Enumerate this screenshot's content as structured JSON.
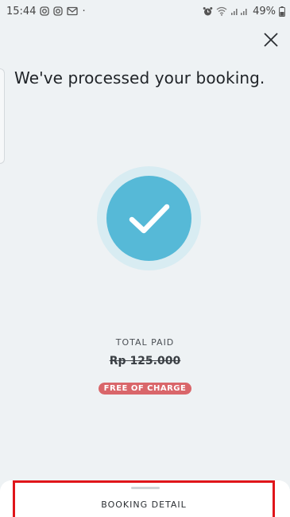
{
  "status_bar": {
    "time": "15:44",
    "battery": "49%"
  },
  "header": {
    "title": "We've processed your booking."
  },
  "payment": {
    "total_label": "TOTAL PAID",
    "original_price": "Rp 125.000",
    "badge": "FREE OF CHARGE"
  },
  "bottom_sheet": {
    "action_label": "BOOKING DETAIL"
  },
  "colors": {
    "background": "#eef2f4",
    "check_fill": "#56b9d7",
    "check_halo": "#d8ecf2",
    "badge": "#d9666a",
    "highlight": "#e0151a"
  },
  "icons": [
    "instagram-icon",
    "instagram-icon",
    "gmail-icon",
    "alarm-icon",
    "wifi-icon",
    "signal-icon",
    "battery-icon",
    "close-icon",
    "checkmark-icon"
  ]
}
